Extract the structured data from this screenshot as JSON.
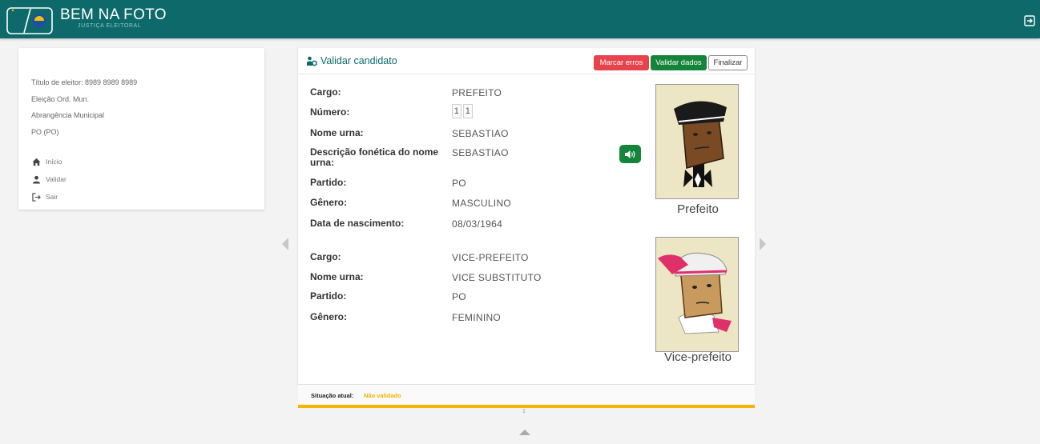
{
  "header": {
    "title": "BEM NA FOTO",
    "subtitle": "JUSTIÇA ELEITORAL"
  },
  "sidebar": {
    "info": [
      "Título de eleitor: 8989 8989 8989",
      "Eleição Ord. Mun.",
      "Abrangência Municipal",
      "PO (PO)"
    ],
    "nav": [
      {
        "label": "Início",
        "icon": "home-icon"
      },
      {
        "label": "Validar",
        "icon": "user-icon"
      },
      {
        "label": "Sair",
        "icon": "logout-icon"
      }
    ]
  },
  "card": {
    "title": "Validar candidato",
    "buttons": {
      "mark_errors": "Marcar erros",
      "validate": "Validar dados",
      "finish": "Finalizar"
    }
  },
  "candidate": {
    "fields": [
      {
        "label": "Cargo:",
        "value": "PREFEITO"
      },
      {
        "label": "Número:",
        "value": ""
      },
      {
        "label": "Nome urna:",
        "value": "SEBASTIAO"
      },
      {
        "label": "Descrição fonética do nome urna:",
        "value": "SEBASTIAO"
      },
      {
        "label": "Partido:",
        "value": "PO"
      },
      {
        "label": "Gênero:",
        "value": "MASCULINO"
      },
      {
        "label": "Data de nascimento:",
        "value": "08/03/1964"
      }
    ],
    "number_digits": [
      "1",
      "1"
    ],
    "photo_caption": "Prefeito"
  },
  "vice": {
    "fields": [
      {
        "label": "Cargo:",
        "value": "VICE-PREFEITO"
      },
      {
        "label": "Nome urna:",
        "value": "VICE SUBSTITUTO"
      },
      {
        "label": "Partido:",
        "value": "PO"
      },
      {
        "label": "Gênero:",
        "value": "FEMININO"
      }
    ],
    "photo_caption": "Vice-prefeito"
  },
  "status": {
    "label": "Situação atual:",
    "value": "Não validado"
  },
  "pagination": {
    "page": "1"
  },
  "colors": {
    "brand": "#0e6a6a",
    "danger": "#e8424d",
    "success": "#14843a",
    "warning": "#f4b400"
  }
}
